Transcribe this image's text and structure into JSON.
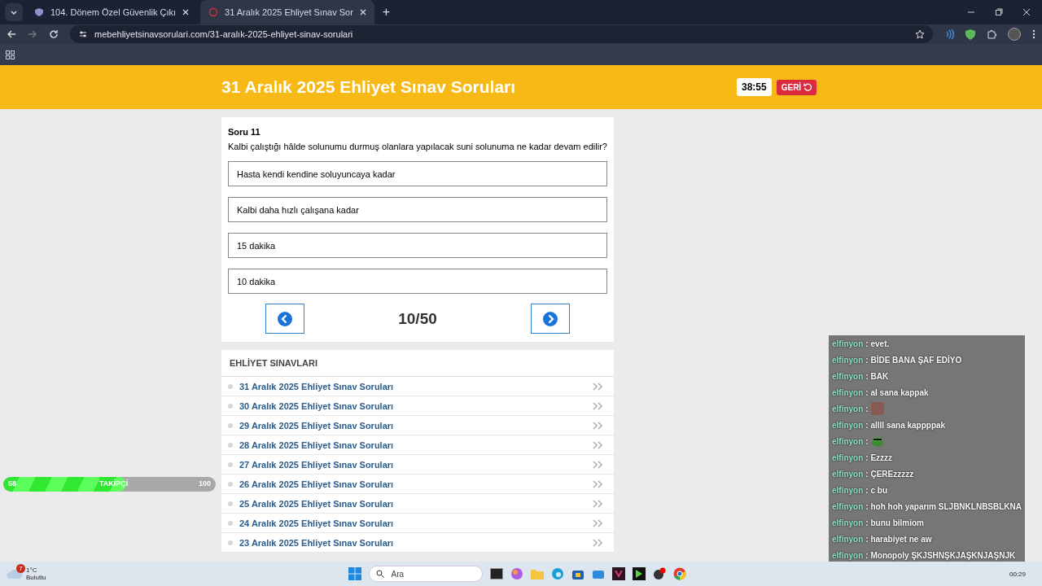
{
  "browser": {
    "tabs": [
      {
        "title": "104. Dönem Özel Güvenlik Çıkı",
        "selected": false
      },
      {
        "title": "31 Aralık 2025 Ehliyet Sınav Sor",
        "selected": true
      }
    ],
    "new_tab": "+",
    "url": "mebehliyetsinavsorulari.com/31-aralık-2025-ehliyet-sinav-sorulari"
  },
  "header": {
    "title": "31 Aralık 2025 Ehliyet Sınav Soruları",
    "timer": "38:55",
    "back_button": "GERİ"
  },
  "question": {
    "number": "Soru 11",
    "text": "Kalbi çalıştığı hâlde solunumu durmuş olanlara yapılacak suni solunuma ne kadar devam edilir?",
    "options": [
      "Hasta kendi kendine soluyuncaya kadar",
      "Kalbi daha hızlı çalışana kadar",
      "15 dakika",
      "10 dakika"
    ],
    "progress": "10/50"
  },
  "exam_list": {
    "title": "EHLİYET SINAVLARI",
    "items": [
      "31 Aralık 2025 Ehliyet Sınav Soruları",
      "30 Aralık 2025 Ehliyet Sınav Soruları",
      "29 Aralık 2025 Ehliyet Sınav Soruları",
      "28 Aralık 2025 Ehliyet Sınav Soruları",
      "27 Aralık 2025 Ehliyet Sınav Soruları",
      "26 Aralık 2025 Ehliyet Sınav Soruları",
      "25 Aralık 2025 Ehliyet Sınav Soruları",
      "24 Aralık 2025 Ehliyet Sınav Soruları",
      "23 Aralık 2025 Ehliyet Sınav Soruları"
    ]
  },
  "chat": [
    {
      "user": "elfinyon",
      "kind": "text",
      "text": ": evet."
    },
    {
      "user": "elfinyon",
      "kind": "text",
      "text": ": BİDE BANA ŞAF EDİYO"
    },
    {
      "user": "elfinyon",
      "kind": "text",
      "text": ": BAK"
    },
    {
      "user": "elfinyon",
      "kind": "text",
      "text": ": al sana kappak"
    },
    {
      "user": "elfinyon",
      "kind": "photo_emote",
      "text": ":"
    },
    {
      "user": "elfinyon",
      "kind": "text",
      "text": ": allll sana kappppak"
    },
    {
      "user": "elfinyon",
      "kind": "frog_emote",
      "text": ":"
    },
    {
      "user": "elfinyon",
      "kind": "text",
      "text": ": Ezzzz"
    },
    {
      "user": "elfinyon",
      "kind": "text",
      "text": ": ÇEREzzzzz"
    },
    {
      "user": "elfinyon",
      "kind": "text",
      "text": ": c bu"
    },
    {
      "user": "elfinyon",
      "kind": "text",
      "text": ": hoh hoh yaparım SLJBNKLNBSBLKNA"
    },
    {
      "user": "elfinyon",
      "kind": "text",
      "text": ": bunu bilmiom"
    },
    {
      "user": "elfinyon",
      "kind": "text",
      "text": ": harabiyet ne aw"
    },
    {
      "user": "elfinyon",
      "kind": "text",
      "text": ": Monopoly ŞKJSHNŞKJAŞKNJAŞNJK"
    }
  ],
  "follower_goal": {
    "current": "58",
    "label": "TAKİPÇİ",
    "target": "100",
    "level": 0.58
  },
  "taskbar": {
    "weather_badge": "7",
    "temperature": "1°C",
    "weather": "Bulutlu",
    "search_placeholder": "Ara",
    "clock": "00:29"
  }
}
